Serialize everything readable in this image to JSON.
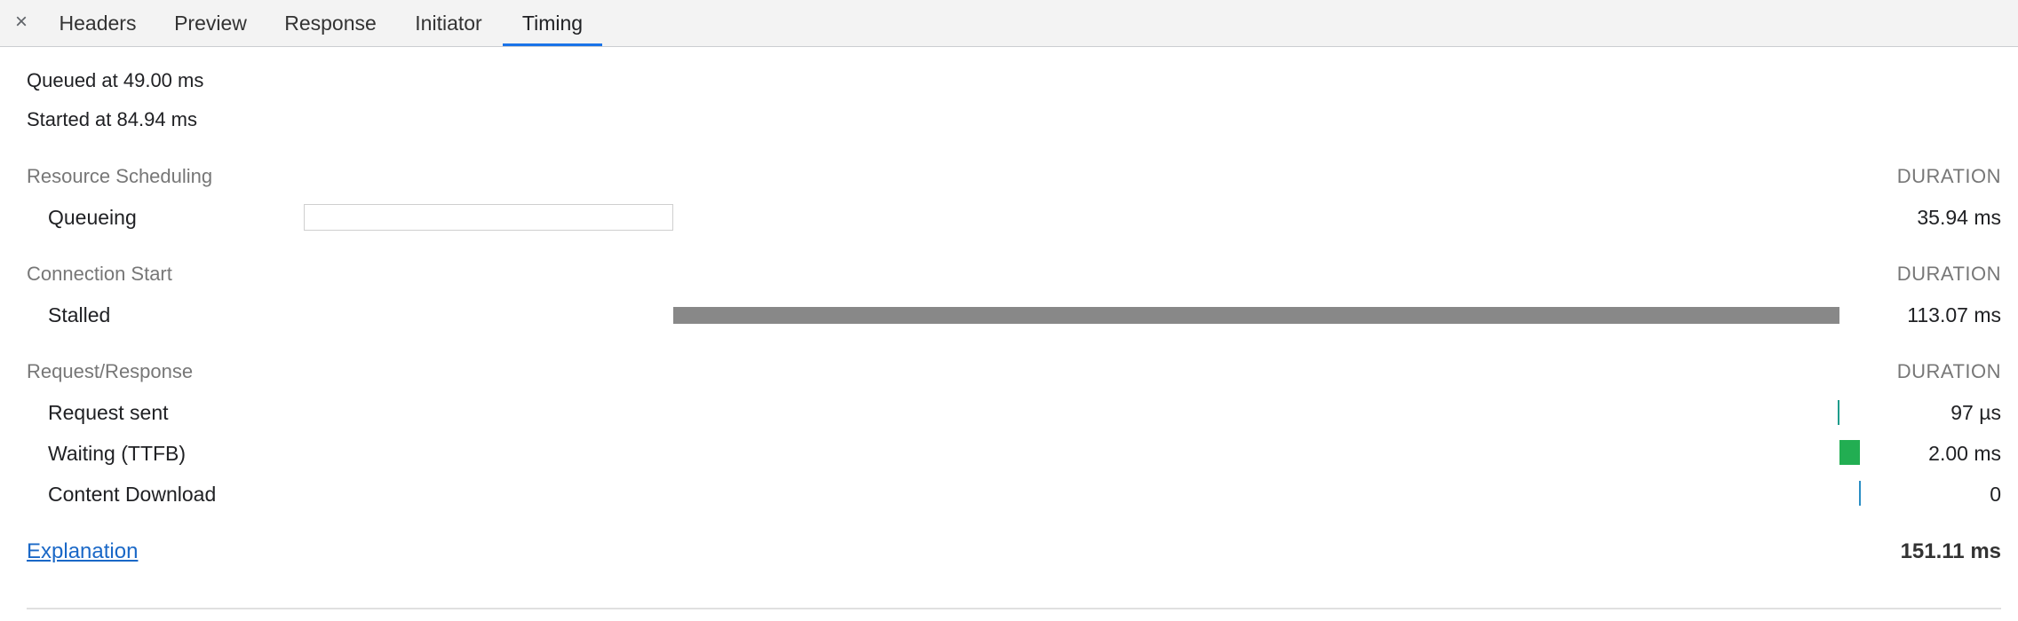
{
  "tabs": {
    "close_icon": "×",
    "items": [
      {
        "label": "Headers",
        "active": false
      },
      {
        "label": "Preview",
        "active": false
      },
      {
        "label": "Response",
        "active": false
      },
      {
        "label": "Initiator",
        "active": false
      },
      {
        "label": "Timing",
        "active": true
      }
    ]
  },
  "timing": {
    "queued_at": "Queued at 49.00 ms",
    "started_at": "Started at 84.94 ms",
    "sections": [
      {
        "title": "Resource Scheduling",
        "duration_header": "DURATION",
        "rows": [
          {
            "label": "Queueing",
            "value": "35.94 ms"
          }
        ]
      },
      {
        "title": "Connection Start",
        "duration_header": "DURATION",
        "rows": [
          {
            "label": "Stalled",
            "value": "113.07 ms"
          }
        ]
      },
      {
        "title": "Request/Response",
        "duration_header": "DURATION",
        "rows": [
          {
            "label": "Request sent",
            "value": "97 µs"
          },
          {
            "label": "Waiting (TTFB)",
            "value": "2.00 ms"
          },
          {
            "label": "Content Download",
            "value": "0"
          }
        ]
      }
    ],
    "explanation_link": "Explanation",
    "total": "151.11 ms"
  },
  "colors": {
    "active_tab": "#1a73e8",
    "stalled_bar": "#888888",
    "request_sent_bar": "#1f9c8c",
    "waiting_bar": "#22ae52",
    "download_bar": "#2a8ec4",
    "link": "#1a68c7"
  }
}
